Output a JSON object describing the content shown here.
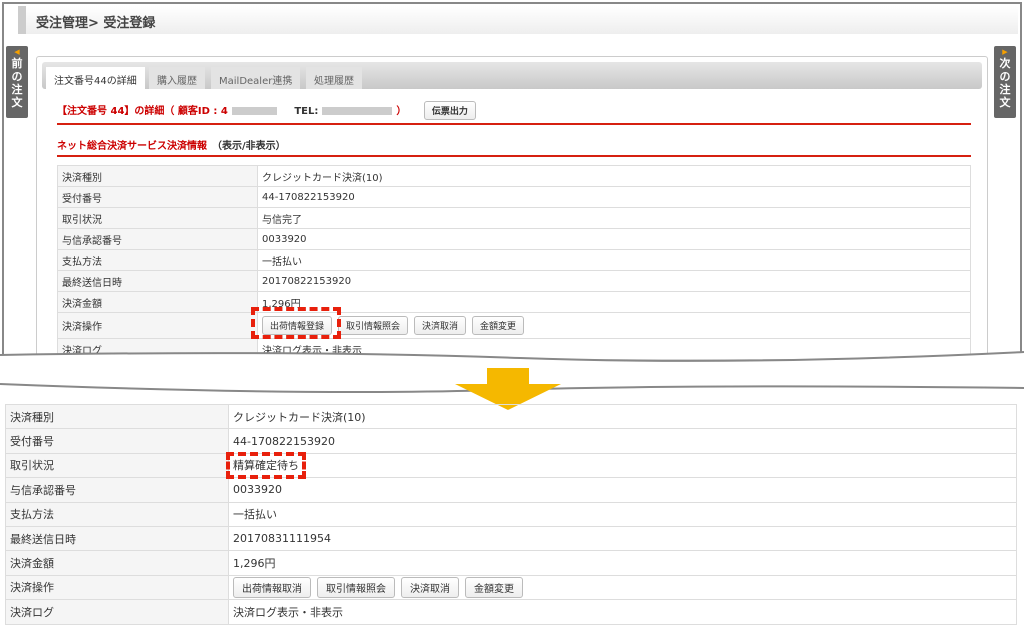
{
  "header": {
    "breadcrumb": "受注管理> 受注登録"
  },
  "nav": {
    "prev": "前の注文",
    "next": "次の注文"
  },
  "tabs": [
    "注文番号44の詳細",
    "購入履歴",
    "MailDealer連携",
    "処理履歴"
  ],
  "order": {
    "title": "【注文番号 44】の詳細（ 顧客ID : 4",
    "tel": "TEL:",
    "close": "）",
    "slip_button": "伝票出力"
  },
  "section": {
    "title": "ネット総合決済サービス決済情報",
    "toggle": "（表示/非表示）"
  },
  "before": {
    "rows": [
      {
        "label": "決済種別",
        "value": "クレジットカード決済(10)"
      },
      {
        "label": "受付番号",
        "value": "44-170822153920"
      },
      {
        "label": "取引状況",
        "value": "与信完了"
      },
      {
        "label": "与信承認番号",
        "value": "0033920"
      },
      {
        "label": "支払方法",
        "value": "一括払い"
      },
      {
        "label": "最終送信日時",
        "value": "20170822153920"
      },
      {
        "label": "決済金額",
        "value": "1,296円"
      },
      {
        "label": "決済操作",
        "buttons": [
          "出荷情報登録",
          "取引情報照会",
          "決済取消",
          "金額変更"
        ]
      },
      {
        "label": "決済ログ",
        "value": "決済ログ表示・非表示"
      }
    ]
  },
  "after": {
    "rows": [
      {
        "label": "決済種別",
        "value": "クレジットカード決済(10)"
      },
      {
        "label": "受付番号",
        "value": "44-170822153920"
      },
      {
        "label": "取引状況",
        "value": "精算確定待ち"
      },
      {
        "label": "与信承認番号",
        "value": "0033920"
      },
      {
        "label": "支払方法",
        "value": "一括払い"
      },
      {
        "label": "最終送信日時",
        "value": "20170831111954"
      },
      {
        "label": "決済金額",
        "value": "1,296円"
      },
      {
        "label": "決済操作",
        "buttons": [
          "出荷情報取消",
          "取引情報照会",
          "決済取消",
          "金額変更"
        ]
      },
      {
        "label": "決済ログ",
        "value": "決済ログ表示・非表示"
      }
    ]
  },
  "colors": {
    "accent": "#d62010",
    "arrow": "#f5b800"
  }
}
